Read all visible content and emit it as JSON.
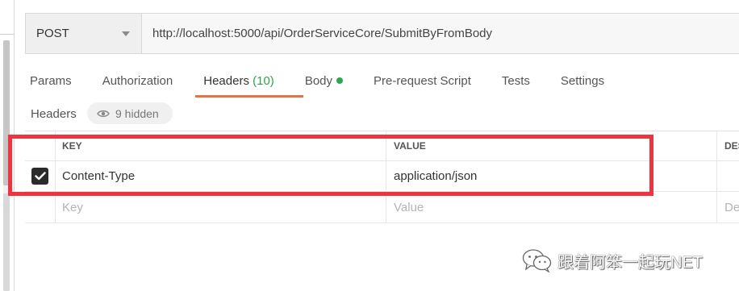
{
  "request": {
    "method": "POST",
    "url": "http://localhost:5000/api/OrderServiceCore/SubmitByFromBody"
  },
  "tabs": [
    {
      "label": "Params"
    },
    {
      "label": "Authorization"
    },
    {
      "label": "Headers",
      "count": "(10)"
    },
    {
      "label": "Body"
    },
    {
      "label": "Pre-request Script"
    },
    {
      "label": "Tests"
    },
    {
      "label": "Settings"
    }
  ],
  "active_tab": "Headers",
  "headers_section": {
    "title": "Headers",
    "hidden_label": "9 hidden"
  },
  "table": {
    "columns": {
      "key": "KEY",
      "value": "VALUE",
      "description": "DES"
    },
    "rows": [
      {
        "checked": true,
        "key": "Content-Type",
        "value": "application/json"
      }
    ],
    "placeholder": {
      "key": "Key",
      "value": "Value",
      "description": "De"
    }
  },
  "watermark": {
    "text": "跟着阿笨一起玩NET"
  },
  "colors": {
    "accent_underline": "#e2744a",
    "header_count": "#31a04b",
    "body_dot": "#2fa54e",
    "highlight_box": "#ef3340",
    "checkbox": "#2b2b2b"
  },
  "icons": {
    "method_dropdown": "chevron-down-icon",
    "hidden_toggle": "eye-icon",
    "checkbox": "checkmark-icon",
    "watermark": "wechat-icon"
  }
}
